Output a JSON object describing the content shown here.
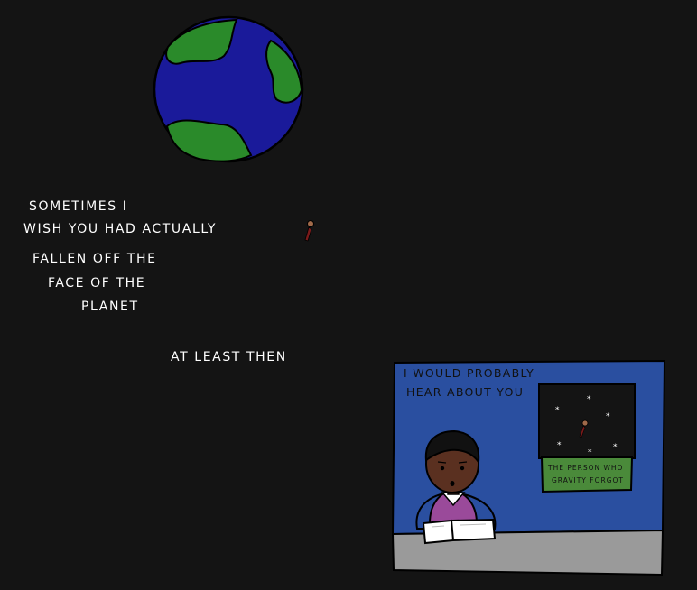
{
  "monologue": {
    "line1": "SOMETIMES I",
    "line2": "WISH YOU HAD ACTUALLY",
    "line3": "FALLEN OFF THE",
    "line4": "FACE OF THE",
    "line5": "PLANET",
    "line6": "AT LEAST THEN"
  },
  "news_panel": {
    "caption_line1": "I WOULD PROBABLY",
    "caption_line2": "HEAR ABOUT YOU",
    "inset_headline_line1": "THE PERSON WHO",
    "inset_headline_line2": "GRAVITY FORGOT"
  },
  "colors": {
    "background": "#141414",
    "earth_ocean": "#1a1a9a",
    "earth_land": "#2a8a2a",
    "tv_backdrop": "#2a4fa0",
    "news_desk": "#9a9a9a",
    "anchor_top": "#9a4a9a",
    "headline_strip": "#4a8a3a"
  }
}
